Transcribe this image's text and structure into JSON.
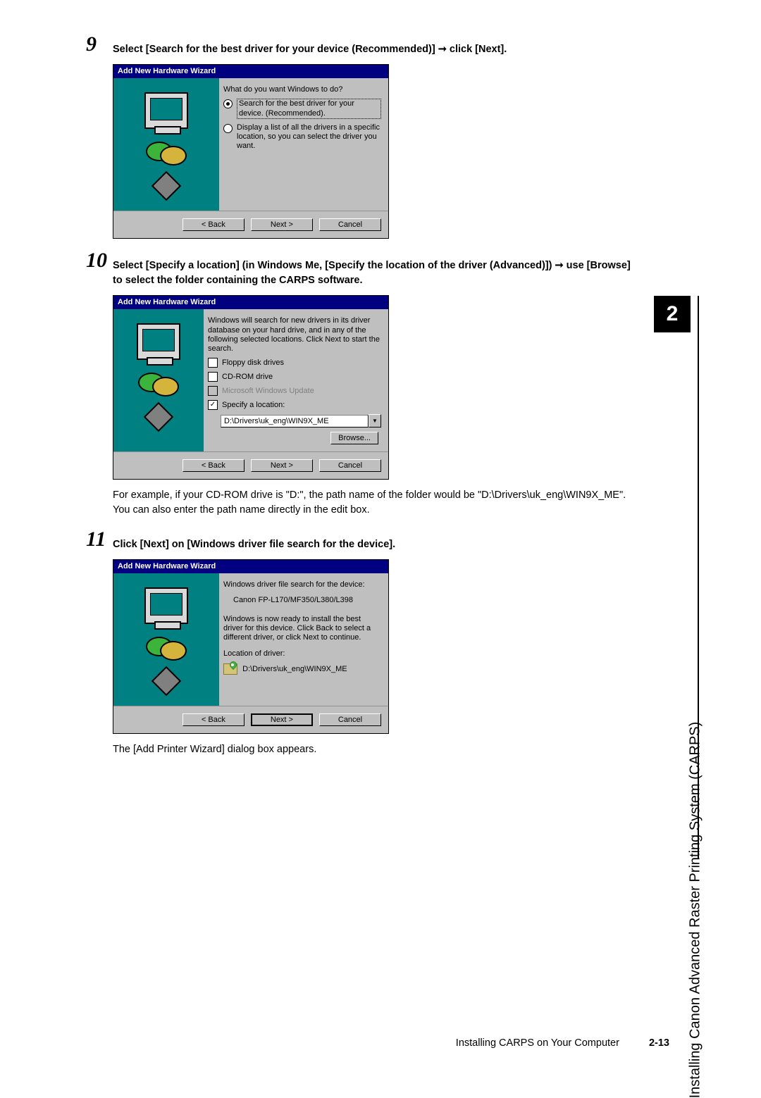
{
  "sidebar": {
    "chapter_number": "2",
    "chapter_title": "Installing Canon Advanced Raster Printing System (CARPS)"
  },
  "footer": {
    "section": "Installing CARPS on Your Computer",
    "page": "2-13"
  },
  "steps": {
    "s9": {
      "num": "9",
      "title": "Select [Search for the best driver for your device (Recommended)] ➞ click [Next].",
      "dlg": {
        "title": "Add New Hardware Wizard",
        "prompt": "What do you want Windows to do?",
        "opt1": "Search for the best driver for your device. (Recommended).",
        "opt2": "Display a list of all the drivers in a specific location, so you can select the driver you want.",
        "back": "< Back",
        "next": "Next >",
        "cancel": "Cancel"
      }
    },
    "s10": {
      "num": "10",
      "title": "Select [Specify a location] (in Windows Me, [Specify the location of the driver (Advanced)]) ➞ use [Browse] to select the folder containing the CARPS software.",
      "dlg": {
        "title": "Add New Hardware Wizard",
        "intro": "Windows will search for new drivers in its driver database on your hard drive, and in any of the following selected locations. Click Next to start the search.",
        "chk_floppy": "Floppy disk drives",
        "chk_cd": "CD-ROM drive",
        "chk_wu": "Microsoft Windows Update",
        "chk_loc": "Specify a location:",
        "path": "D:\\Drivers\\uk_eng\\WIN9X_ME",
        "browse": "Browse...",
        "back": "< Back",
        "next": "Next >",
        "cancel": "Cancel"
      },
      "note": "For example, if your CD-ROM drive is \"D:\", the path name of the folder would be \"D:\\Drivers\\uk_eng\\WIN9X_ME\". You can also enter the path name directly in the edit box."
    },
    "s11": {
      "num": "11",
      "title": "Click [Next] on [Windows driver file search for the device].",
      "dlg": {
        "title": "Add New Hardware Wizard",
        "line1": "Windows driver file search for the device:",
        "device": "Canon FP-L170/MF350/L380/L398",
        "desc": "Windows is now ready to install the best driver for this device. Click Back to select a different driver, or click Next to continue.",
        "loc_label": "Location of driver:",
        "path": "D:\\Drivers\\uk_eng\\WIN9X_ME",
        "back": "< Back",
        "next": "Next >",
        "cancel": "Cancel"
      },
      "after": "The [Add Printer Wizard] dialog box appears."
    }
  }
}
